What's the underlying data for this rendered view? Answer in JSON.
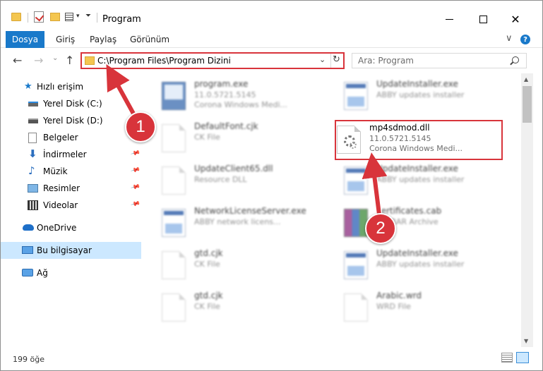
{
  "window": {
    "title": "Program",
    "minimize_glyph": "—",
    "close_glyph": "✕"
  },
  "ribbon": {
    "tabs": [
      "Dosya",
      "Giriş",
      "Paylaş",
      "Görünüm"
    ],
    "help_glyph": "?",
    "chevron": "∨"
  },
  "address": {
    "path": "C:\\Program Files\\Program Dizini",
    "search_placeholder": "Ara: Program"
  },
  "sidebar": {
    "items": [
      {
        "label": "Hızlı erişim"
      },
      {
        "label": "Yerel Disk (C:)"
      },
      {
        "label": "Yerel Disk (D:)"
      },
      {
        "label": "Belgeler"
      },
      {
        "label": "İndirmeler"
      },
      {
        "label": "Müzik"
      },
      {
        "label": "Resimler"
      },
      {
        "label": "Videolar"
      },
      {
        "label": "OneDrive"
      },
      {
        "label": "Bu bilgisayar"
      },
      {
        "label": "Ağ"
      }
    ]
  },
  "files": {
    "f0": {
      "name": "program.exe",
      "line2": "11.0.5721.5145",
      "line3": "Corona Windows Medi..."
    },
    "f1": {
      "name": "UpdateInstaller.exe",
      "line2": "ABBY updates installer",
      "line3": ""
    },
    "f2": {
      "name": "DefaultFont.cjk",
      "line2": "CK File",
      "line3": ""
    },
    "f3": {
      "name": "mp4sdmod.dll",
      "line2": "11.0.5721.5145",
      "line3": "Corona Windows Medi..."
    },
    "f4": {
      "name": "UpdateClient65.dll",
      "line2": "Resource DLL",
      "line3": ""
    },
    "f5": {
      "name": "UpdateInstaller.exe",
      "line2": "ABBY updates installer",
      "line3": ""
    },
    "f6": {
      "name": "NetworkLicenseServer.exe",
      "line2": "ABBY network licens...",
      "line3": ""
    },
    "f7": {
      "name": "certificates.cab",
      "line2": "WinRAR Archive",
      "line3": ""
    },
    "f8": {
      "name": "gtd.cjk",
      "line2": "CK File",
      "line3": ""
    },
    "f9": {
      "name": "UpdateInstaller.exe",
      "line2": "ABBY updates installer",
      "line3": ""
    },
    "f10": {
      "name": "gtd.cjk",
      "line2": "CK File",
      "line3": ""
    },
    "f11": {
      "name": "Arabic.wrd",
      "line2": "WRD File",
      "line3": ""
    }
  },
  "status": {
    "item_count": "199 öğe"
  },
  "callouts": {
    "one": "1",
    "two": "2"
  },
  "colors": {
    "accent": "#1979ca",
    "highlight": "#d8343b",
    "selection": "#cce8ff"
  }
}
